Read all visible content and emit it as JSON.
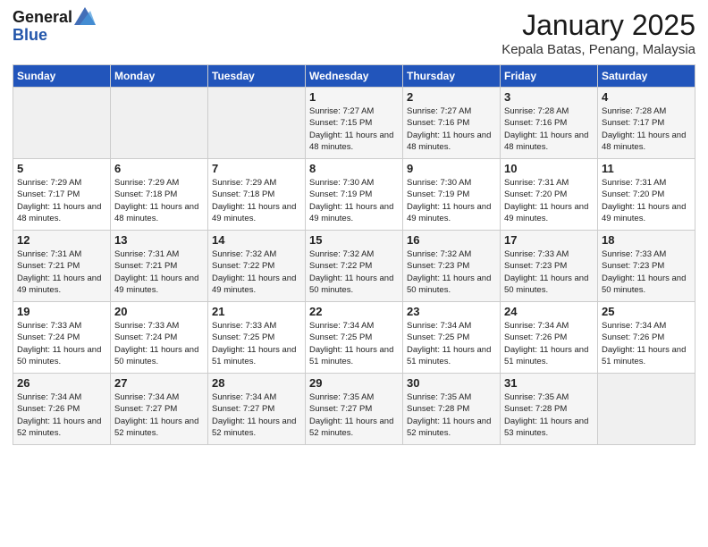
{
  "logo": {
    "general": "General",
    "blue": "Blue"
  },
  "header": {
    "title": "January 2025",
    "location": "Kepala Batas, Penang, Malaysia"
  },
  "days_of_week": [
    "Sunday",
    "Monday",
    "Tuesday",
    "Wednesday",
    "Thursday",
    "Friday",
    "Saturday"
  ],
  "weeks": [
    [
      {
        "day": "",
        "info": ""
      },
      {
        "day": "",
        "info": ""
      },
      {
        "day": "",
        "info": ""
      },
      {
        "day": "1",
        "info": "Sunrise: 7:27 AM\nSunset: 7:15 PM\nDaylight: 11 hours and 48 minutes."
      },
      {
        "day": "2",
        "info": "Sunrise: 7:27 AM\nSunset: 7:16 PM\nDaylight: 11 hours and 48 minutes."
      },
      {
        "day": "3",
        "info": "Sunrise: 7:28 AM\nSunset: 7:16 PM\nDaylight: 11 hours and 48 minutes."
      },
      {
        "day": "4",
        "info": "Sunrise: 7:28 AM\nSunset: 7:17 PM\nDaylight: 11 hours and 48 minutes."
      }
    ],
    [
      {
        "day": "5",
        "info": "Sunrise: 7:29 AM\nSunset: 7:17 PM\nDaylight: 11 hours and 48 minutes."
      },
      {
        "day": "6",
        "info": "Sunrise: 7:29 AM\nSunset: 7:18 PM\nDaylight: 11 hours and 48 minutes."
      },
      {
        "day": "7",
        "info": "Sunrise: 7:29 AM\nSunset: 7:18 PM\nDaylight: 11 hours and 49 minutes."
      },
      {
        "day": "8",
        "info": "Sunrise: 7:30 AM\nSunset: 7:19 PM\nDaylight: 11 hours and 49 minutes."
      },
      {
        "day": "9",
        "info": "Sunrise: 7:30 AM\nSunset: 7:19 PM\nDaylight: 11 hours and 49 minutes."
      },
      {
        "day": "10",
        "info": "Sunrise: 7:31 AM\nSunset: 7:20 PM\nDaylight: 11 hours and 49 minutes."
      },
      {
        "day": "11",
        "info": "Sunrise: 7:31 AM\nSunset: 7:20 PM\nDaylight: 11 hours and 49 minutes."
      }
    ],
    [
      {
        "day": "12",
        "info": "Sunrise: 7:31 AM\nSunset: 7:21 PM\nDaylight: 11 hours and 49 minutes."
      },
      {
        "day": "13",
        "info": "Sunrise: 7:31 AM\nSunset: 7:21 PM\nDaylight: 11 hours and 49 minutes."
      },
      {
        "day": "14",
        "info": "Sunrise: 7:32 AM\nSunset: 7:22 PM\nDaylight: 11 hours and 49 minutes."
      },
      {
        "day": "15",
        "info": "Sunrise: 7:32 AM\nSunset: 7:22 PM\nDaylight: 11 hours and 50 minutes."
      },
      {
        "day": "16",
        "info": "Sunrise: 7:32 AM\nSunset: 7:23 PM\nDaylight: 11 hours and 50 minutes."
      },
      {
        "day": "17",
        "info": "Sunrise: 7:33 AM\nSunset: 7:23 PM\nDaylight: 11 hours and 50 minutes."
      },
      {
        "day": "18",
        "info": "Sunrise: 7:33 AM\nSunset: 7:23 PM\nDaylight: 11 hours and 50 minutes."
      }
    ],
    [
      {
        "day": "19",
        "info": "Sunrise: 7:33 AM\nSunset: 7:24 PM\nDaylight: 11 hours and 50 minutes."
      },
      {
        "day": "20",
        "info": "Sunrise: 7:33 AM\nSunset: 7:24 PM\nDaylight: 11 hours and 50 minutes."
      },
      {
        "day": "21",
        "info": "Sunrise: 7:33 AM\nSunset: 7:25 PM\nDaylight: 11 hours and 51 minutes."
      },
      {
        "day": "22",
        "info": "Sunrise: 7:34 AM\nSunset: 7:25 PM\nDaylight: 11 hours and 51 minutes."
      },
      {
        "day": "23",
        "info": "Sunrise: 7:34 AM\nSunset: 7:25 PM\nDaylight: 11 hours and 51 minutes."
      },
      {
        "day": "24",
        "info": "Sunrise: 7:34 AM\nSunset: 7:26 PM\nDaylight: 11 hours and 51 minutes."
      },
      {
        "day": "25",
        "info": "Sunrise: 7:34 AM\nSunset: 7:26 PM\nDaylight: 11 hours and 51 minutes."
      }
    ],
    [
      {
        "day": "26",
        "info": "Sunrise: 7:34 AM\nSunset: 7:26 PM\nDaylight: 11 hours and 52 minutes."
      },
      {
        "day": "27",
        "info": "Sunrise: 7:34 AM\nSunset: 7:27 PM\nDaylight: 11 hours and 52 minutes."
      },
      {
        "day": "28",
        "info": "Sunrise: 7:34 AM\nSunset: 7:27 PM\nDaylight: 11 hours and 52 minutes."
      },
      {
        "day": "29",
        "info": "Sunrise: 7:35 AM\nSunset: 7:27 PM\nDaylight: 11 hours and 52 minutes."
      },
      {
        "day": "30",
        "info": "Sunrise: 7:35 AM\nSunset: 7:28 PM\nDaylight: 11 hours and 52 minutes."
      },
      {
        "day": "31",
        "info": "Sunrise: 7:35 AM\nSunset: 7:28 PM\nDaylight: 11 hours and 53 minutes."
      },
      {
        "day": "",
        "info": ""
      }
    ]
  ]
}
